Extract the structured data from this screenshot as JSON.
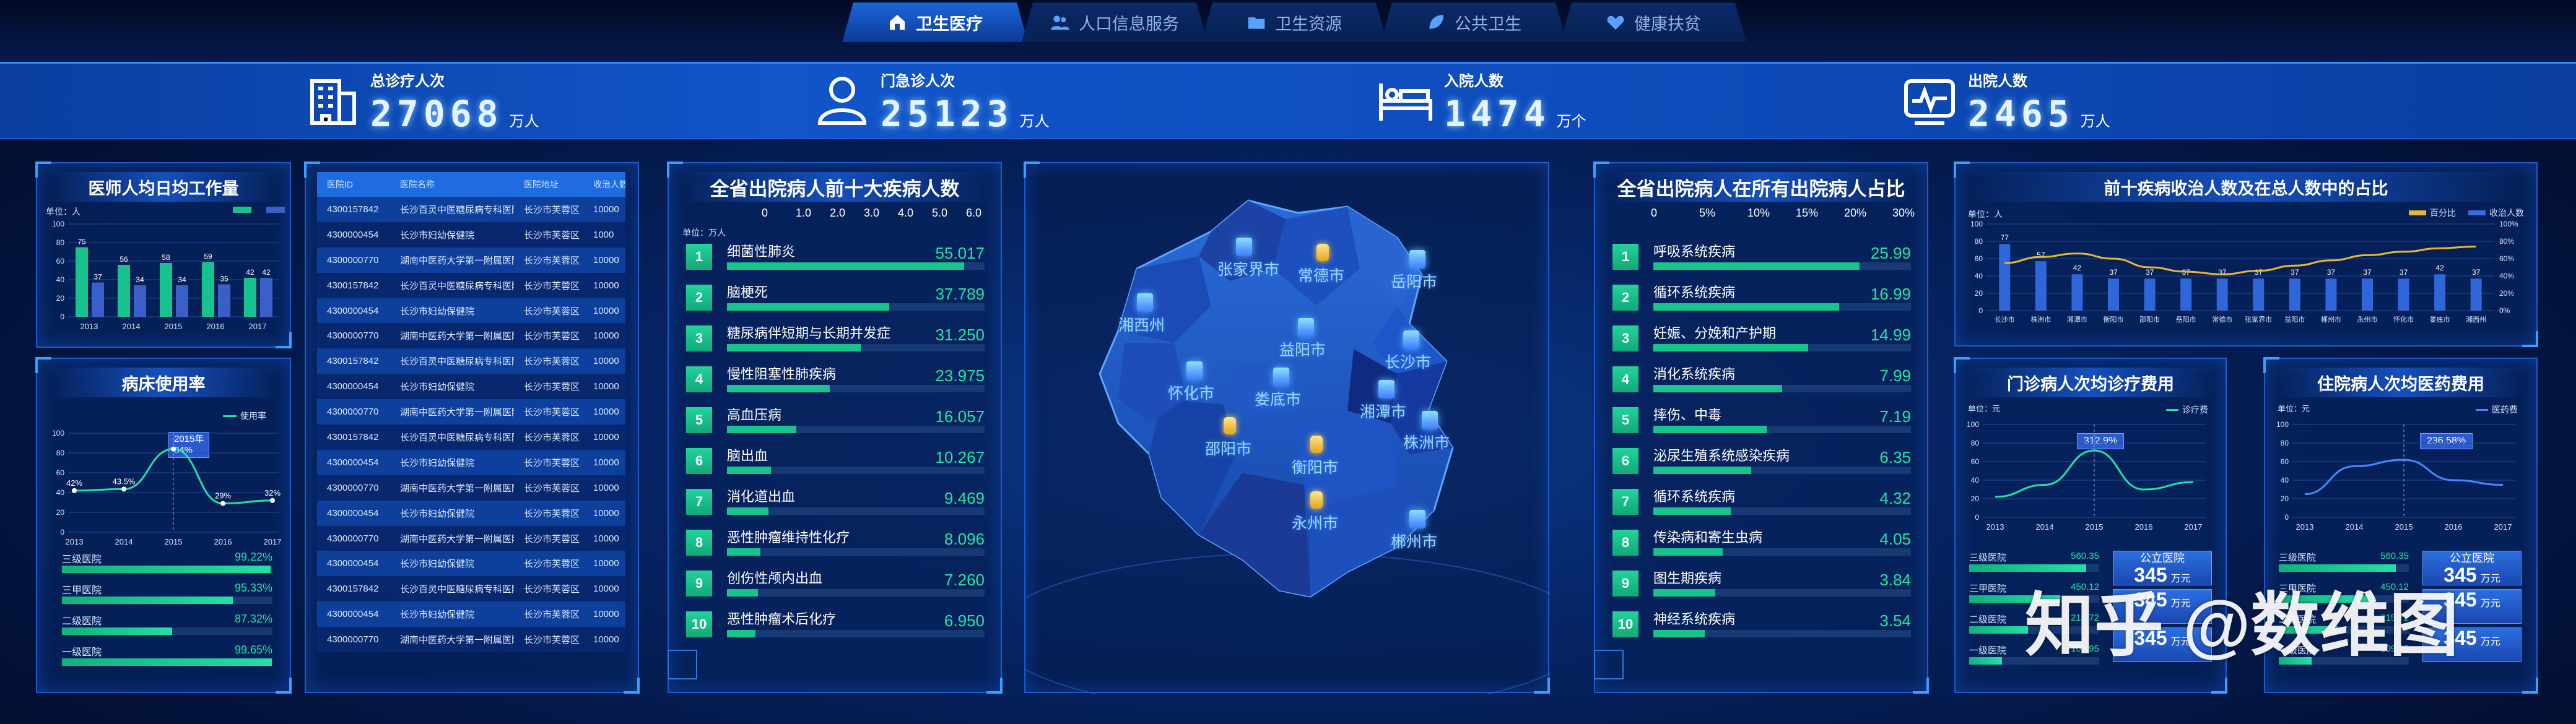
{
  "nav": {
    "tabs": [
      {
        "label": "卫生医疗",
        "icon": "home-icon"
      },
      {
        "label": "人口信息服务",
        "icon": "people-icon"
      },
      {
        "label": "卫生资源",
        "icon": "folder-icon"
      },
      {
        "label": "公共卫生",
        "icon": "leaf-icon"
      },
      {
        "label": "健康扶贫",
        "icon": "heart-icon"
      }
    ],
    "active_tab": "卫生医疗"
  },
  "kpis": [
    {
      "label": "总诊疗人次",
      "value": "27068",
      "unit": "万人",
      "icon": "building-icon"
    },
    {
      "label": "门急诊人次",
      "value": "25123",
      "unit": "万人",
      "icon": "user-icon"
    },
    {
      "label": "入院人数",
      "value": "1474",
      "unit": "万个",
      "icon": "bed-icon"
    },
    {
      "label": "出院人数",
      "value": "2465",
      "unit": "万人",
      "icon": "monitor-icon"
    }
  ],
  "doctor_workload": {
    "title": "医师人均日均工作量",
    "unit": "单位：人",
    "chart_data": {
      "type": "bar",
      "categories": [
        "2013",
        "2014",
        "2015",
        "2016",
        "2017"
      ],
      "series": [
        {
          "values": [
            75,
            56,
            58,
            59,
            42
          ],
          "color": "#18c28e"
        },
        {
          "values": [
            37,
            34,
            34,
            35,
            42
          ],
          "color": "#3a5fc8"
        }
      ],
      "ylim": [
        0,
        100
      ],
      "yticks": [
        0,
        20,
        40,
        60,
        80,
        100
      ]
    }
  },
  "bed_usage": {
    "title": "病床使用率",
    "legend": "使用率",
    "tooltip": {
      "year": "2015年",
      "value": "84%"
    },
    "chart_data": {
      "type": "line",
      "x": [
        "2013",
        "2014",
        "2015",
        "2016",
        "2017"
      ],
      "values": [
        42,
        43.5,
        84,
        29,
        32
      ],
      "labels": [
        "42%",
        "43.5%",
        "84%",
        "29%",
        "32%"
      ],
      "ylim": [
        0,
        100
      ],
      "yticks": [
        0,
        20,
        40,
        60,
        80,
        100
      ]
    },
    "hospital_levels": [
      {
        "name": "三级医院",
        "value": "99.22%",
        "pct": 99.22
      },
      {
        "name": "三甲医院",
        "value": "95.33%",
        "pct": 95.33
      },
      {
        "name": "二级医院",
        "value": "87.32%",
        "pct": 87.32
      },
      {
        "name": "一级医院",
        "value": "99.65%",
        "pct": 99.65
      }
    ]
  },
  "hospital_table": {
    "headers": [
      "医院ID",
      "医院名称",
      "医院地址",
      "收治人数"
    ],
    "rows": [
      [
        "4300157842",
        "长沙百灵中医糖尿病专科医院",
        "长沙市芙蓉区",
        "10000"
      ],
      [
        "4300000454",
        "长沙市妇幼保健院",
        "长沙市芙蓉区",
        "1000"
      ],
      [
        "4300000770",
        "湖南中医药大学第一附属医院",
        "长沙市芙蓉区",
        "10000"
      ],
      [
        "4300157842",
        "长沙百灵中医糖尿病专科医院",
        "长沙市芙蓉区",
        "10000"
      ],
      [
        "4300000454",
        "长沙市妇幼保健院",
        "长沙市芙蓉区",
        "10000"
      ],
      [
        "4300000770",
        "湖南中医药大学第一附属医院",
        "长沙市芙蓉区",
        "10000"
      ],
      [
        "4300157842",
        "长沙百灵中医糖尿病专科医院",
        "长沙市芙蓉区",
        "10000"
      ],
      [
        "4300000454",
        "长沙市妇幼保健院",
        "长沙市芙蓉区",
        "10000"
      ],
      [
        "4300000770",
        "湖南中医药大学第一附属医院",
        "长沙市芙蓉区",
        "10000"
      ],
      [
        "4300157842",
        "长沙百灵中医糖尿病专科医院",
        "长沙市芙蓉区",
        "10000"
      ],
      [
        "4300000454",
        "长沙市妇幼保健院",
        "长沙市芙蓉区",
        "10000"
      ],
      [
        "4300000770",
        "湖南中医药大学第一附属医院",
        "长沙市芙蓉区",
        "10000"
      ],
      [
        "4300000454",
        "长沙市妇幼保健院",
        "长沙市芙蓉区",
        "10000"
      ],
      [
        "4300000770",
        "湖南中医药大学第一附属医院",
        "长沙市芙蓉区",
        "10000"
      ],
      [
        "4300000454",
        "长沙市妇幼保健院",
        "长沙市芙蓉区",
        "10000"
      ],
      [
        "4300157842",
        "长沙百灵中医糖尿病专科医院",
        "长沙市芙蓉区",
        "10000"
      ],
      [
        "4300000454",
        "长沙市妇幼保健院",
        "长沙市芙蓉区",
        "10000"
      ],
      [
        "4300000770",
        "湖南中医药大学第一附属医院",
        "长沙市芙蓉区",
        "10000"
      ]
    ]
  },
  "top_diseases": {
    "title": "全省出院病人前十大疾病人数",
    "unit": "单位：万人",
    "axis_ticks": [
      "0",
      "1.0",
      "2.0",
      "3.0",
      "4.0",
      "5.0",
      "6.0"
    ],
    "items": [
      {
        "rank": "1",
        "name": "细菌性肺炎",
        "value": "55.017",
        "pct": 0.92
      },
      {
        "rank": "2",
        "name": "脑梗死",
        "value": "37.789",
        "pct": 0.63
      },
      {
        "rank": "3",
        "name": "糖尿病伴短期与长期并发症",
        "value": "31.250",
        "pct": 0.52
      },
      {
        "rank": "4",
        "name": "慢性阻塞性肺疾病",
        "value": "23.975",
        "pct": 0.4
      },
      {
        "rank": "5",
        "name": "高血压病",
        "value": "16.057",
        "pct": 0.27
      },
      {
        "rank": "6",
        "name": "脑出血",
        "value": "10.267",
        "pct": 0.17
      },
      {
        "rank": "7",
        "name": "消化道出血",
        "value": "9.469",
        "pct": 0.16
      },
      {
        "rank": "8",
        "name": "恶性肿瘤维持性化疗",
        "value": "8.096",
        "pct": 0.13
      },
      {
        "rank": "9",
        "name": "创伤性颅内出血",
        "value": "7.260",
        "pct": 0.12
      },
      {
        "rank": "10",
        "name": "恶性肿瘤术后化疗",
        "value": "6.950",
        "pct": 0.11
      }
    ]
  },
  "map": {
    "cities": [
      "张家界市",
      "常德市",
      "岳阳市",
      "湘西州",
      "益阳市",
      "长沙市",
      "怀化市",
      "娄底市",
      "湘潭市",
      "邵阳市",
      "衡阳市",
      "株洲市",
      "永州市",
      "郴州市"
    ]
  },
  "disease_ratio": {
    "title": "全省出院病人在所有出院病人占比",
    "axis_ticks": [
      "0",
      "5%",
      "10%",
      "15%",
      "20%",
      "30%"
    ],
    "items": [
      {
        "rank": "1",
        "name": "呼吸系统疾病",
        "value": "25.99",
        "pct": 0.8
      },
      {
        "rank": "2",
        "name": "循环系统疾病",
        "value": "16.99",
        "pct": 0.72
      },
      {
        "rank": "3",
        "name": "妊娠、分娩和产护期",
        "value": "14.99",
        "pct": 0.6
      },
      {
        "rank": "4",
        "name": "消化系统疾病",
        "value": "7.99",
        "pct": 0.5
      },
      {
        "rank": "5",
        "name": "摔伤、中毒",
        "value": "7.19",
        "pct": 0.44
      },
      {
        "rank": "6",
        "name": "泌尿生殖系统感染疾病",
        "value": "6.35",
        "pct": 0.38
      },
      {
        "rank": "7",
        "name": "循环系统疾病",
        "value": "4.32",
        "pct": 0.3
      },
      {
        "rank": "8",
        "name": "传染病和寄生虫病",
        "value": "4.05",
        "pct": 0.27
      },
      {
        "rank": "9",
        "name": "图生期疾病",
        "value": "3.84",
        "pct": 0.24
      },
      {
        "rank": "10",
        "name": "神经系统疾病",
        "value": "3.54",
        "pct": 0.2
      }
    ]
  },
  "top10_ratio": {
    "title": "前十疾病收治人数及在总人数中的占比",
    "unit": "单位：人",
    "legend": [
      "百分比",
      "收治人数"
    ],
    "chart_data": {
      "type": "bar",
      "categories": [
        "长沙市",
        "株洲市",
        "湘潭市",
        "衡阳市",
        "邵阳市",
        "岳阳市",
        "常德市",
        "张家界市",
        "益阳市",
        "郴州市",
        "永州市",
        "怀化市",
        "娄底市",
        "湘西州"
      ],
      "values": [
        77,
        57,
        42,
        37,
        37,
        37,
        37,
        37,
        37,
        37,
        37,
        37,
        42,
        37
      ],
      "line_values": [
        55,
        62,
        66,
        60,
        50,
        45,
        42,
        46,
        52,
        58,
        64,
        68,
        72,
        74
      ],
      "ylim": [
        0,
        100
      ],
      "yticks": [
        0,
        20,
        40,
        60,
        80,
        100
      ],
      "y2ticks": [
        "0%",
        "20%",
        "40%",
        "60%",
        "80%",
        "100%"
      ]
    }
  },
  "outpatient_cost": {
    "title": "门诊病人次均诊疗费用",
    "unit": "单位：元",
    "legend": "诊疗费",
    "tooltip": "312.9%",
    "chart_data": {
      "type": "line",
      "x": [
        "2013",
        "2014",
        "2015",
        "2016",
        "2017"
      ],
      "values": [
        22,
        35,
        72,
        30,
        38
      ],
      "ylim": [
        0,
        100
      ],
      "yticks": [
        0,
        20,
        40,
        60,
        80,
        100
      ]
    },
    "levels": [
      {
        "name": "三级医院",
        "value": "560.35",
        "pct": 0.9
      },
      {
        "name": "三甲医院",
        "value": "450.12",
        "pct": 0.7
      },
      {
        "name": "二级医院",
        "value": "215.72",
        "pct": 0.45
      },
      {
        "name": "一级医院",
        "value": "109.95",
        "pct": 0.25
      }
    ],
    "boxes": [
      {
        "label": "公立医院",
        "value": "345",
        "unit": "万元"
      },
      {
        "label": "",
        "value": "345",
        "unit": "万元"
      },
      {
        "label": "",
        "value": "345",
        "unit": "万元"
      }
    ]
  },
  "inpatient_cost": {
    "title": "住院病人次均医药费用",
    "unit": "单位：元",
    "legend": "医药费",
    "tooltip": "236.58%",
    "chart_data": {
      "type": "line",
      "x": [
        "2013",
        "2014",
        "2015",
        "2016",
        "2017"
      ],
      "values": [
        25,
        55,
        62,
        40,
        35
      ],
      "ylim": [
        0,
        100
      ],
      "yticks": [
        0,
        20,
        40,
        60,
        80,
        100
      ]
    },
    "levels": [
      {
        "name": "三级医院",
        "value": "560.35",
        "pct": 0.9
      },
      {
        "name": "三甲医院",
        "value": "450.12",
        "pct": 0.7
      },
      {
        "name": "二级医院",
        "value": "215.72",
        "pct": 0.45
      },
      {
        "name": "一级医院",
        "value": "109.95",
        "pct": 0.25
      }
    ],
    "boxes": [
      {
        "label": "公立医院",
        "value": "345",
        "unit": "万元"
      },
      {
        "label": "",
        "value": "345",
        "unit": "万元"
      },
      {
        "label": "",
        "value": "345",
        "unit": "万元"
      }
    ]
  },
  "watermark": "知乎 @数维图"
}
